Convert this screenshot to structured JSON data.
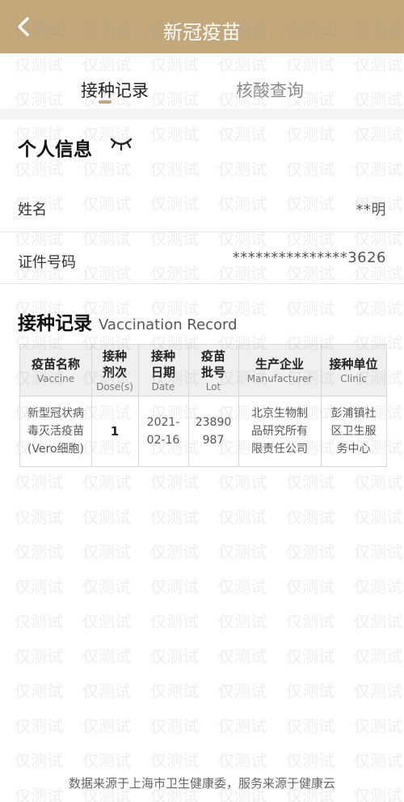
{
  "header": {
    "title": "新冠疫苗",
    "bg_color": "#c2a87a",
    "back_icon": "chevron-left-icon"
  },
  "tabs": [
    {
      "label": "接种记录",
      "active": true
    },
    {
      "label": "核酸查询",
      "active": false
    }
  ],
  "personal": {
    "title": "个人信息",
    "eye_icon": "eye-closed-icon",
    "name_label": "姓名",
    "name_value": "**明",
    "id_label": "证件号码",
    "id_value": "***************3626"
  },
  "record": {
    "title": "接种记录",
    "subtitle": "Vaccination Record",
    "columns": [
      {
        "cn": "疫苗名称",
        "en": "Vaccine"
      },
      {
        "cn": "接种剂次",
        "en": "Dose(s)"
      },
      {
        "cn": "接种日期",
        "en": "Date"
      },
      {
        "cn": "疫苗批号",
        "en": "Lot"
      },
      {
        "cn": "生产企业",
        "en": "Manufacturer"
      },
      {
        "cn": "接种单位",
        "en": "Clinic"
      }
    ],
    "row": {
      "vaccine": [
        "新型冠状病",
        "毒灭活疫苗",
        "(Vero细胞)"
      ],
      "dose": "1",
      "date": [
        "2021-",
        "02-16"
      ],
      "lot": [
        "23890",
        "987"
      ],
      "manufacturer": [
        "北京生物制",
        "品研究所有",
        "限责任公司"
      ],
      "clinic": [
        "彭浦镇社",
        "区卫生服",
        "务中心"
      ]
    }
  },
  "footer": {
    "text": "数据来源于上海市卫生健康委，服务来源于健康云"
  },
  "watermark": {
    "text": "仅测试"
  }
}
